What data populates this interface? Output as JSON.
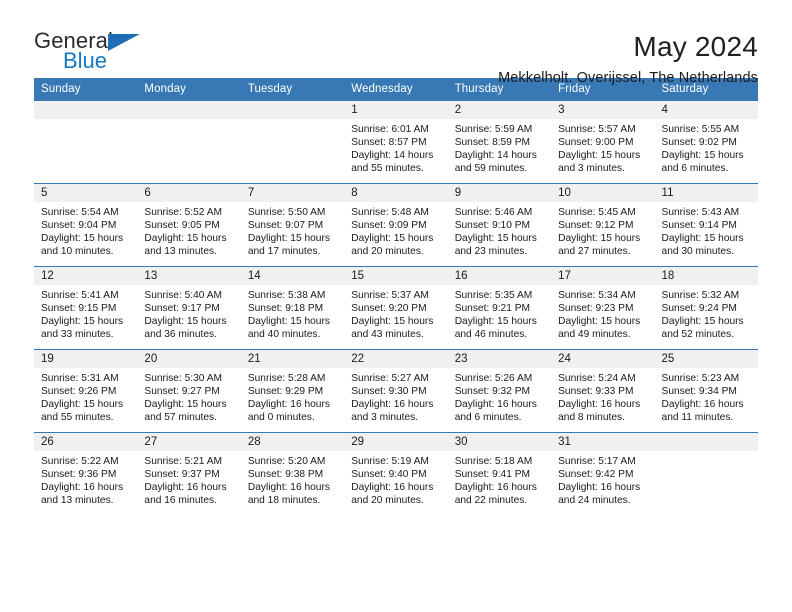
{
  "logo": {
    "primary_text": "General",
    "secondary_text": "Blue",
    "triangle_color": "#1f6db5",
    "secondary_color": "#1678c2"
  },
  "header": {
    "month_title": "May 2024",
    "location": "Mekkelholt, Overijssel, The Netherlands"
  },
  "theme": {
    "header_blue": "#3878b4",
    "daynum_band": "#f0f0f0",
    "text": "#1b1b1b"
  },
  "calendar": {
    "weekday_headers": [
      "Sunday",
      "Monday",
      "Tuesday",
      "Wednesday",
      "Thursday",
      "Friday",
      "Saturday"
    ],
    "weeks": [
      [
        {
          "day": "",
          "blank": true
        },
        {
          "day": "",
          "blank": true
        },
        {
          "day": "",
          "blank": true
        },
        {
          "day": "1",
          "sunrise": "Sunrise: 6:01 AM",
          "sunset": "Sunset: 8:57 PM",
          "daylight": "Daylight: 14 hours and 55 minutes."
        },
        {
          "day": "2",
          "sunrise": "Sunrise: 5:59 AM",
          "sunset": "Sunset: 8:59 PM",
          "daylight": "Daylight: 14 hours and 59 minutes."
        },
        {
          "day": "3",
          "sunrise": "Sunrise: 5:57 AM",
          "sunset": "Sunset: 9:00 PM",
          "daylight": "Daylight: 15 hours and 3 minutes."
        },
        {
          "day": "4",
          "sunrise": "Sunrise: 5:55 AM",
          "sunset": "Sunset: 9:02 PM",
          "daylight": "Daylight: 15 hours and 6 minutes."
        }
      ],
      [
        {
          "day": "5",
          "sunrise": "Sunrise: 5:54 AM",
          "sunset": "Sunset: 9:04 PM",
          "daylight": "Daylight: 15 hours and 10 minutes."
        },
        {
          "day": "6",
          "sunrise": "Sunrise: 5:52 AM",
          "sunset": "Sunset: 9:05 PM",
          "daylight": "Daylight: 15 hours and 13 minutes."
        },
        {
          "day": "7",
          "sunrise": "Sunrise: 5:50 AM",
          "sunset": "Sunset: 9:07 PM",
          "daylight": "Daylight: 15 hours and 17 minutes."
        },
        {
          "day": "8",
          "sunrise": "Sunrise: 5:48 AM",
          "sunset": "Sunset: 9:09 PM",
          "daylight": "Daylight: 15 hours and 20 minutes."
        },
        {
          "day": "9",
          "sunrise": "Sunrise: 5:46 AM",
          "sunset": "Sunset: 9:10 PM",
          "daylight": "Daylight: 15 hours and 23 minutes."
        },
        {
          "day": "10",
          "sunrise": "Sunrise: 5:45 AM",
          "sunset": "Sunset: 9:12 PM",
          "daylight": "Daylight: 15 hours and 27 minutes."
        },
        {
          "day": "11",
          "sunrise": "Sunrise: 5:43 AM",
          "sunset": "Sunset: 9:14 PM",
          "daylight": "Daylight: 15 hours and 30 minutes."
        }
      ],
      [
        {
          "day": "12",
          "sunrise": "Sunrise: 5:41 AM",
          "sunset": "Sunset: 9:15 PM",
          "daylight": "Daylight: 15 hours and 33 minutes."
        },
        {
          "day": "13",
          "sunrise": "Sunrise: 5:40 AM",
          "sunset": "Sunset: 9:17 PM",
          "daylight": "Daylight: 15 hours and 36 minutes."
        },
        {
          "day": "14",
          "sunrise": "Sunrise: 5:38 AM",
          "sunset": "Sunset: 9:18 PM",
          "daylight": "Daylight: 15 hours and 40 minutes."
        },
        {
          "day": "15",
          "sunrise": "Sunrise: 5:37 AM",
          "sunset": "Sunset: 9:20 PM",
          "daylight": "Daylight: 15 hours and 43 minutes."
        },
        {
          "day": "16",
          "sunrise": "Sunrise: 5:35 AM",
          "sunset": "Sunset: 9:21 PM",
          "daylight": "Daylight: 15 hours and 46 minutes."
        },
        {
          "day": "17",
          "sunrise": "Sunrise: 5:34 AM",
          "sunset": "Sunset: 9:23 PM",
          "daylight": "Daylight: 15 hours and 49 minutes."
        },
        {
          "day": "18",
          "sunrise": "Sunrise: 5:32 AM",
          "sunset": "Sunset: 9:24 PM",
          "daylight": "Daylight: 15 hours and 52 minutes."
        }
      ],
      [
        {
          "day": "19",
          "sunrise": "Sunrise: 5:31 AM",
          "sunset": "Sunset: 9:26 PM",
          "daylight": "Daylight: 15 hours and 55 minutes."
        },
        {
          "day": "20",
          "sunrise": "Sunrise: 5:30 AM",
          "sunset": "Sunset: 9:27 PM",
          "daylight": "Daylight: 15 hours and 57 minutes."
        },
        {
          "day": "21",
          "sunrise": "Sunrise: 5:28 AM",
          "sunset": "Sunset: 9:29 PM",
          "daylight": "Daylight: 16 hours and 0 minutes."
        },
        {
          "day": "22",
          "sunrise": "Sunrise: 5:27 AM",
          "sunset": "Sunset: 9:30 PM",
          "daylight": "Daylight: 16 hours and 3 minutes."
        },
        {
          "day": "23",
          "sunrise": "Sunrise: 5:26 AM",
          "sunset": "Sunset: 9:32 PM",
          "daylight": "Daylight: 16 hours and 6 minutes."
        },
        {
          "day": "24",
          "sunrise": "Sunrise: 5:24 AM",
          "sunset": "Sunset: 9:33 PM",
          "daylight": "Daylight: 16 hours and 8 minutes."
        },
        {
          "day": "25",
          "sunrise": "Sunrise: 5:23 AM",
          "sunset": "Sunset: 9:34 PM",
          "daylight": "Daylight: 16 hours and 11 minutes."
        }
      ],
      [
        {
          "day": "26",
          "sunrise": "Sunrise: 5:22 AM",
          "sunset": "Sunset: 9:36 PM",
          "daylight": "Daylight: 16 hours and 13 minutes."
        },
        {
          "day": "27",
          "sunrise": "Sunrise: 5:21 AM",
          "sunset": "Sunset: 9:37 PM",
          "daylight": "Daylight: 16 hours and 16 minutes."
        },
        {
          "day": "28",
          "sunrise": "Sunrise: 5:20 AM",
          "sunset": "Sunset: 9:38 PM",
          "daylight": "Daylight: 16 hours and 18 minutes."
        },
        {
          "day": "29",
          "sunrise": "Sunrise: 5:19 AM",
          "sunset": "Sunset: 9:40 PM",
          "daylight": "Daylight: 16 hours and 20 minutes."
        },
        {
          "day": "30",
          "sunrise": "Sunrise: 5:18 AM",
          "sunset": "Sunset: 9:41 PM",
          "daylight": "Daylight: 16 hours and 22 minutes."
        },
        {
          "day": "31",
          "sunrise": "Sunrise: 5:17 AM",
          "sunset": "Sunset: 9:42 PM",
          "daylight": "Daylight: 16 hours and 24 minutes."
        },
        {
          "day": "",
          "blank": true
        }
      ]
    ]
  }
}
